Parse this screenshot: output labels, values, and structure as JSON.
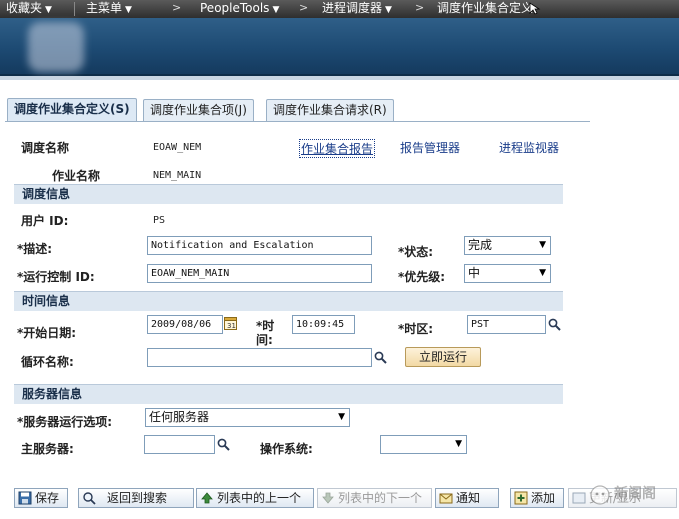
{
  "nav": {
    "favorites": "收藏夹",
    "main_menu": "主菜单",
    "separator": ">",
    "peopletools": "PeopleTools",
    "process_scheduler": "进程调度器",
    "current_page": "调度作业集合定义"
  },
  "tabs": [
    {
      "label": "调度作业集合定义(S)",
      "active": true
    },
    {
      "label": "调度作业集合项(J)",
      "active": false
    },
    {
      "label": "调度作业集合请求(R)",
      "active": false
    }
  ],
  "header": {
    "schedule_name_label": "调度名称",
    "schedule_name_value": "EOAW_NEM",
    "job_name_label": "作业名称",
    "job_name_value": "NEM_MAIN",
    "links": {
      "jobset_report": "作业集合报告",
      "report_manager": "报告管理器",
      "process_monitor": "进程监视器"
    }
  },
  "schedule_info": {
    "section_title": "调度信息",
    "user_id_label": "用户 ID:",
    "user_id_value": "PS",
    "description_label": "*描述:",
    "description_value": "Notification and Escalation",
    "status_label": "*状态:",
    "status_value": "完成",
    "run_control_label": "*运行控制 ID:",
    "run_control_value": "EOAW_NEM_MAIN",
    "priority_label": "*优先级:",
    "priority_value": "中"
  },
  "time_info": {
    "section_title": "时间信息",
    "start_date_label": "*开始日期:",
    "start_date_value": "2009/08/06",
    "time_label_line1": "*时",
    "time_label_line2": "间:",
    "time_value": "10:09:45",
    "timezone_label": "*时区:",
    "timezone_value": "PST",
    "recurrence_label": "循环名称:",
    "recurrence_value": "",
    "run_now_label": "立即运行"
  },
  "server_info": {
    "section_title": "服务器信息",
    "run_option_label": "*服务器运行选项:",
    "run_option_value": "任何服务器",
    "primary_server_label": "主服务器:",
    "primary_server_value": "",
    "os_label": "操作系统:",
    "os_value": ""
  },
  "toolbar": {
    "save": "保存",
    "return_to_search": "返回到搜索",
    "previous_in_list": "列表中的上一个",
    "next_in_list": "列表中的下一个",
    "notify": "通知",
    "add": "添加",
    "update_display": "更新/显示"
  },
  "watermark": {
    "text": "新阁阁"
  },
  "colors": {
    "nav_bar": "#3a3a3a",
    "banner": "#1d4a73",
    "section_bg": "#dde7f1",
    "link": "#1a3d8a",
    "run_button": "#f2d9a4"
  }
}
